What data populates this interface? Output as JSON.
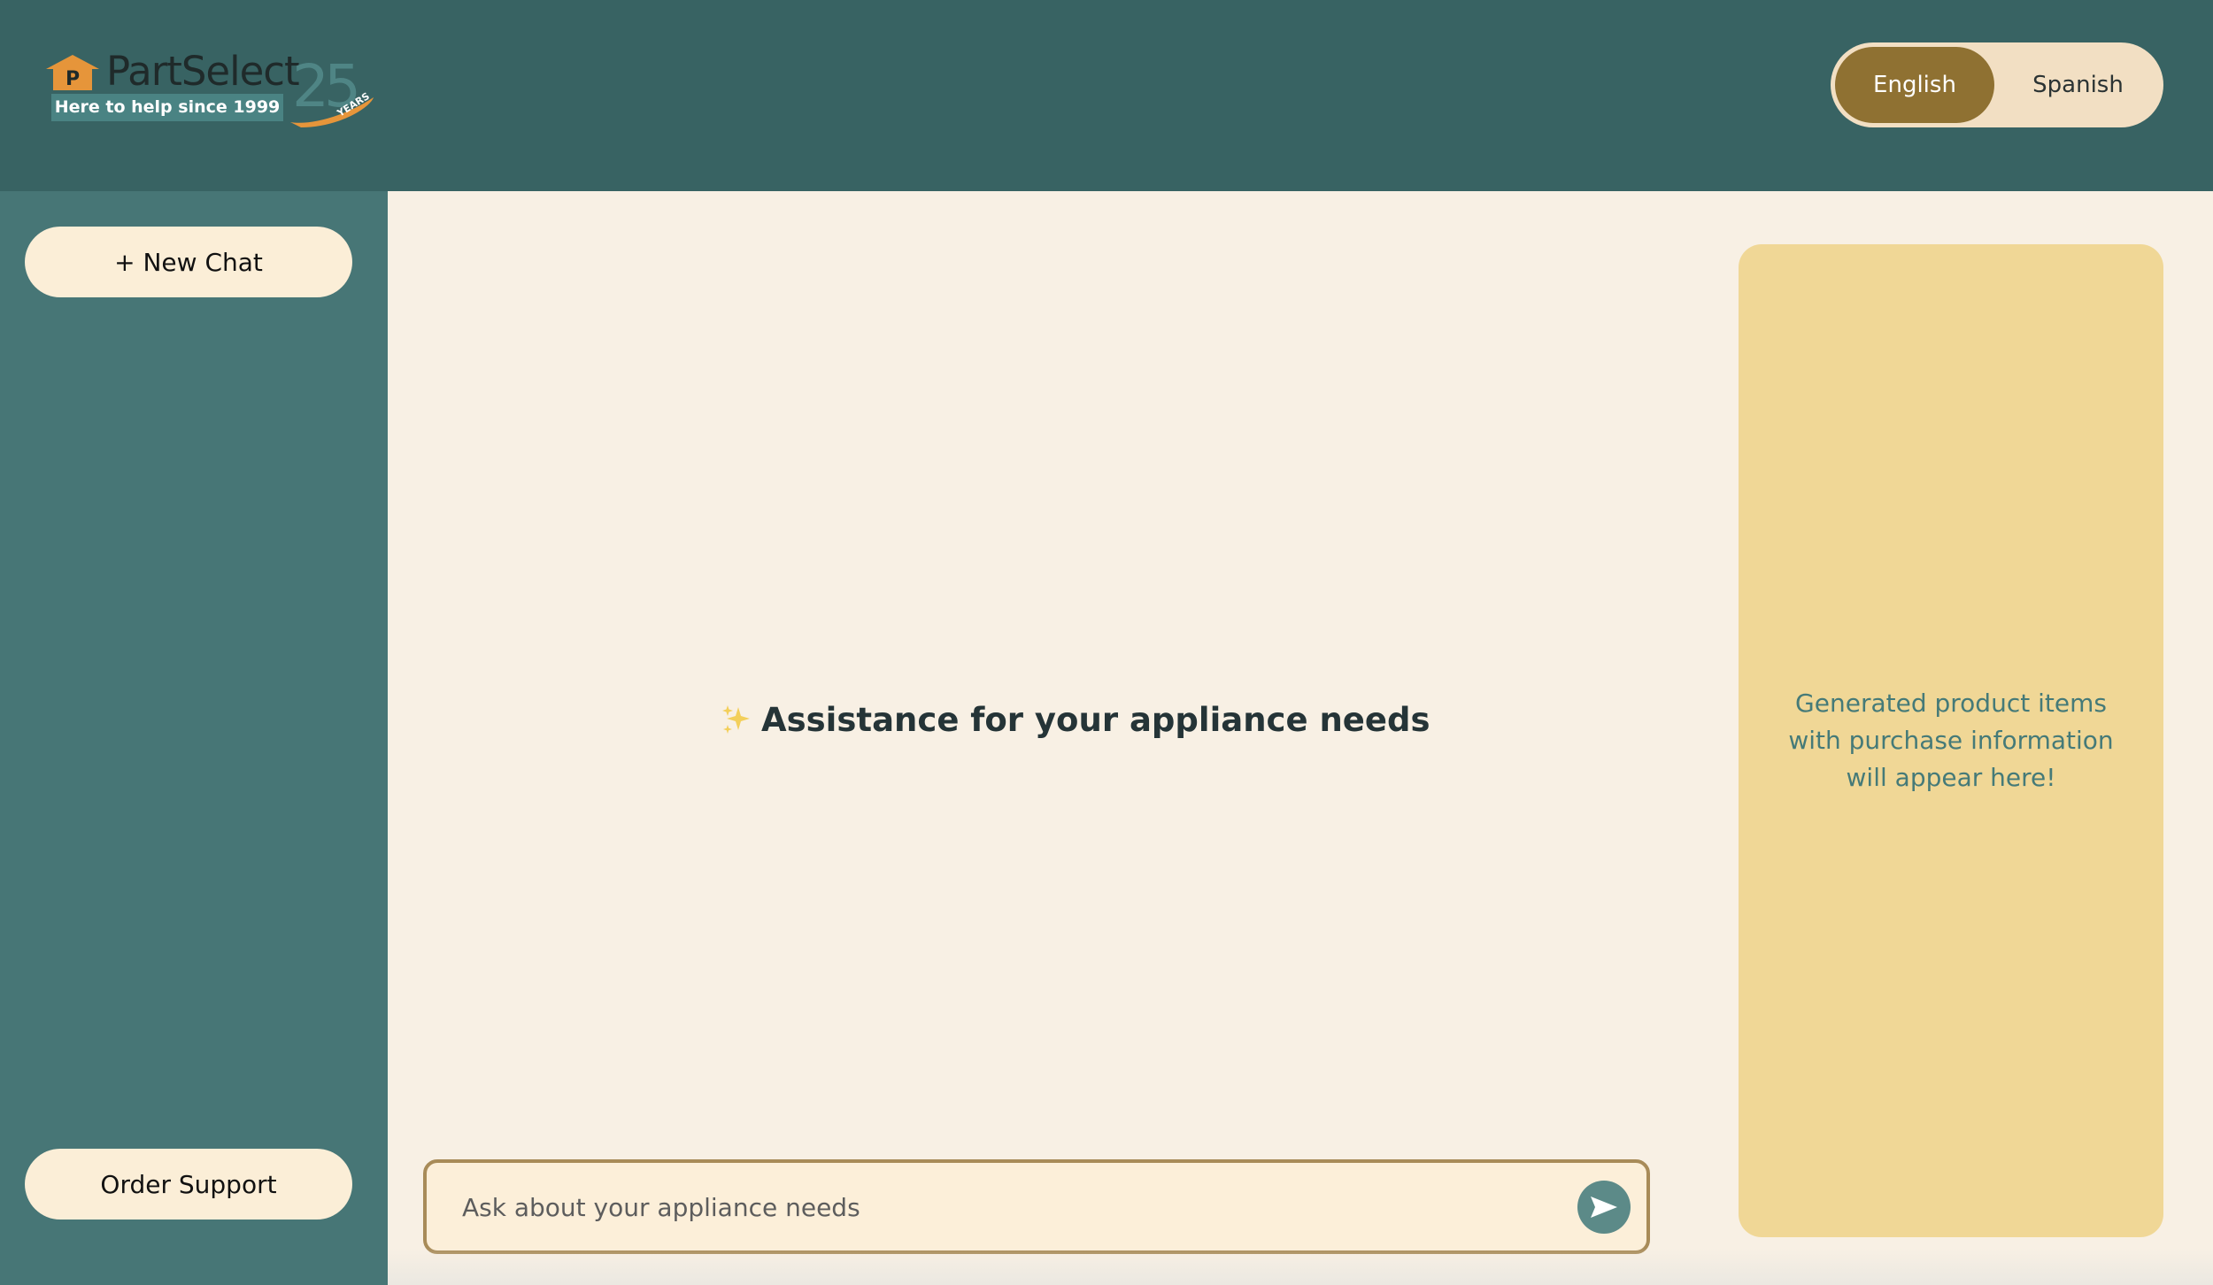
{
  "header": {
    "logo": {
      "brand": "PartSelect",
      "tagline": "Here to help since 1999",
      "anniversary_number": "25",
      "anniversary_word": "YEARS"
    },
    "language_toggle": {
      "options": [
        "English",
        "Spanish"
      ],
      "selected": "English"
    }
  },
  "sidebar": {
    "new_chat_label": "+ New Chat",
    "order_support_label": "Order Support"
  },
  "main": {
    "hero_text": "Assistance for your appliance needs",
    "hero_icon": "sparkles-icon"
  },
  "chat_input": {
    "placeholder": "Ask about your appliance needs",
    "value": "",
    "send_icon": "send-arrow-icon"
  },
  "product_panel": {
    "message": "Generated product items with purchase information will appear here!"
  },
  "colors": {
    "header_bg": "#386363",
    "sidebar_bg": "#477676",
    "main_bg": "#f8f0e4",
    "accent_gold": "#8f7132",
    "product_panel_bg": "#f0d796",
    "button_bg": "#fbeed7"
  }
}
